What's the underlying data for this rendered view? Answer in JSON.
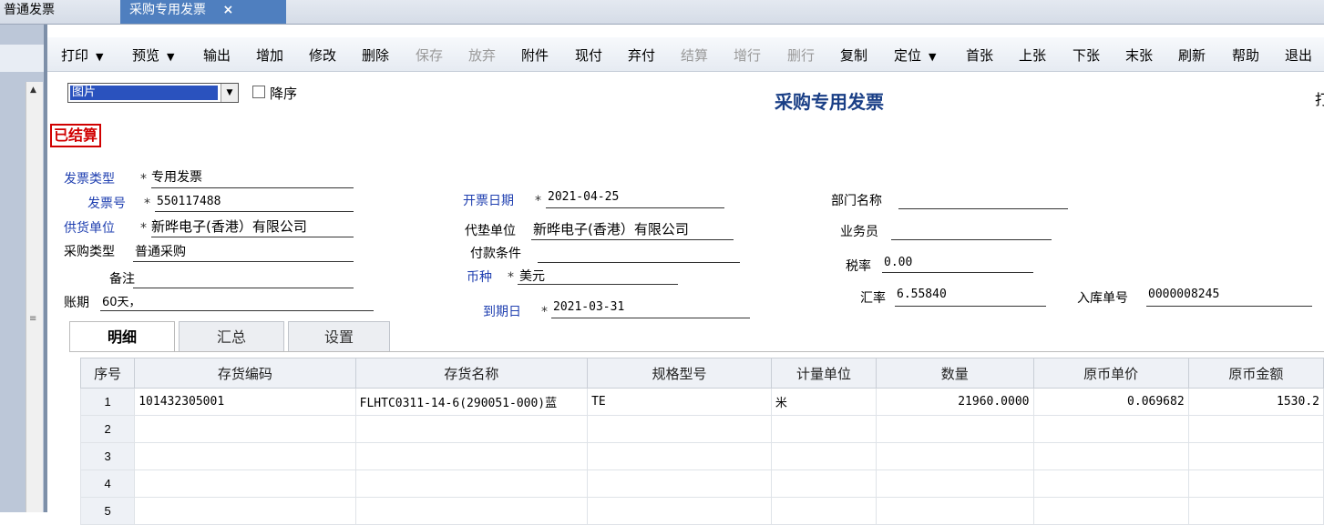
{
  "tabs": [
    {
      "label": "普通发票"
    },
    {
      "label": "采购专用发票",
      "close": "×"
    }
  ],
  "toolbar": {
    "items": [
      {
        "label": "打印",
        "dropdown": true
      },
      {
        "label": "预览",
        "dropdown": true
      },
      {
        "label": "输出"
      },
      {
        "label": "增加"
      },
      {
        "label": "修改"
      },
      {
        "label": "删除"
      },
      {
        "label": "保存",
        "disabled": true
      },
      {
        "label": "放弃",
        "disabled": true
      },
      {
        "label": "附件"
      },
      {
        "label": "现付"
      },
      {
        "label": "弃付"
      },
      {
        "label": "结算",
        "disabled": true
      },
      {
        "label": "增行",
        "disabled": true
      },
      {
        "label": "删行",
        "disabled": true
      },
      {
        "label": "复制"
      },
      {
        "label": "定位",
        "dropdown": true
      },
      {
        "label": "首张"
      },
      {
        "label": "上张"
      },
      {
        "label": "下张"
      },
      {
        "label": "末张"
      },
      {
        "label": "刷新"
      },
      {
        "label": "帮助"
      },
      {
        "label": "退出"
      }
    ],
    "dropdown_icon": "▼"
  },
  "header": {
    "template_select": "图片",
    "combo_arrow": "▼",
    "sort_desc_label": "降序",
    "title": "采购专用发票",
    "cut_text": "打",
    "status_stamp": "已结算"
  },
  "form": {
    "required_mark": "*",
    "invoice_type": {
      "label": "发票类型",
      "value": "专用发票"
    },
    "invoice_no": {
      "label": "发票号",
      "value": "550117488"
    },
    "supplier": {
      "label": "供货单位",
      "value": "新晔电子(香港）有限公司"
    },
    "purchase_type": {
      "label": "采购类型",
      "value": "普通采购"
    },
    "remark": {
      "label": "备注",
      "value": ""
    },
    "account_period": {
      "label": "账期",
      "value": "60天，"
    },
    "invoice_date": {
      "label": "开票日期",
      "value": "2021-04-25"
    },
    "advance_unit": {
      "label": "代垫单位",
      "value": "新晔电子(香港）有限公司"
    },
    "payment_terms": {
      "label": "付款条件",
      "value": ""
    },
    "currency": {
      "label": "币种",
      "value": "美元"
    },
    "due_date": {
      "label": "到期日",
      "value": "2021-03-31"
    },
    "department": {
      "label": "部门名称",
      "value": ""
    },
    "salesperson": {
      "label": "业务员",
      "value": ""
    },
    "tax_rate": {
      "label": "税率",
      "value": "0.00"
    },
    "exchange_rate": {
      "label": "汇率",
      "value": "6.55840"
    },
    "warehouse_no": {
      "label": "入库单号",
      "value": "0000008245"
    }
  },
  "detail_tabs": [
    "明细",
    "汇总",
    "设置"
  ],
  "grid": {
    "columns": [
      "序号",
      "存货编码",
      "存货名称",
      "规格型号",
      "计量单位",
      "数量",
      "原币单价",
      "原币金额"
    ],
    "rows": [
      [
        "1",
        "101432305001",
        "FLHTC0311-14-6(290051-000)蓝",
        "TE",
        "米",
        "21960.0000",
        "0.069682",
        "1530.2"
      ],
      [
        "2",
        "",
        "",
        "",
        "",
        "",
        "",
        ""
      ],
      [
        "3",
        "",
        "",
        "",
        "",
        "",
        "",
        ""
      ],
      [
        "4",
        "",
        "",
        "",
        "",
        "",
        "",
        ""
      ],
      [
        "5",
        "",
        "",
        "",
        "",
        "",
        "",
        ""
      ]
    ]
  },
  "icons": {
    "scroll_up": "▲",
    "scroll_grip": "≡"
  }
}
